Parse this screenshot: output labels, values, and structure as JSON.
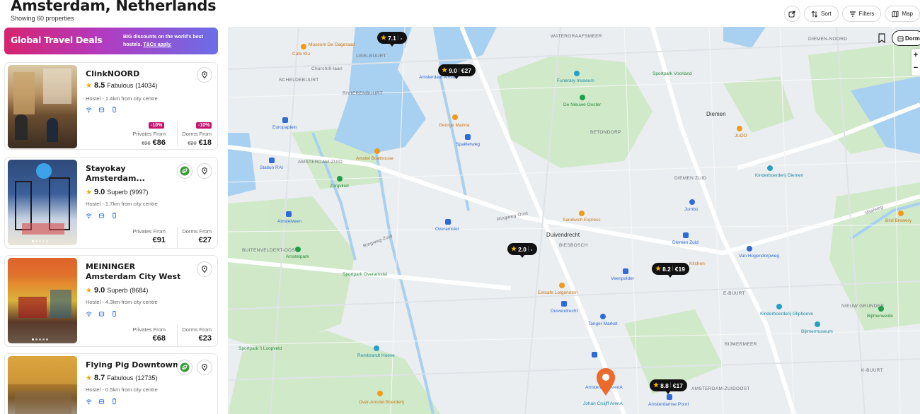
{
  "header": {
    "title": "Amsterdam, Netherlands",
    "subtitle": "Showing 60 properties",
    "sort_label": "Sort",
    "filters_label": "Filters",
    "map_label": "Map"
  },
  "banner": {
    "title": "Global Travel Deals",
    "text": "BIG discounts on the world's best hostels.",
    "link": "T&Cs apply."
  },
  "properties": [
    {
      "name": "ClinkNOORD",
      "score": "8.5",
      "rating_word": "Fabulous",
      "reviews": "(14034)",
      "meta": "Hostel - 1.4km from city centre",
      "privates_label": "Privates From",
      "privates_old": "€96",
      "privates_price": "€86",
      "privates_discount": "-10%",
      "dorms_label": "Dorms From",
      "dorms_old": "€20",
      "dorms_price": "€18",
      "dorms_discount": "-10%"
    },
    {
      "name": "Stayokay Amsterdam...",
      "score": "9.0",
      "rating_word": "Superb",
      "reviews": "(9997)",
      "meta": "Hostel - 1.7km from city centre",
      "privates_label": "Privates From",
      "privates_price": "€91",
      "dorms_label": "Dorms From",
      "dorms_price": "€27"
    },
    {
      "name": "MEININGER Amsterdam City West",
      "score": "9.0",
      "rating_word": "Superb",
      "reviews": "(8684)",
      "meta": "Hostel - 4.3km from city centre",
      "privates_label": "Privates From",
      "privates_price": "€68",
      "dorms_label": "Dorms From",
      "dorms_price": "€23"
    },
    {
      "name": "Flying Pig Downtown",
      "score": "8.7",
      "rating_word": "Fabulous",
      "reviews": "(12735)",
      "meta": "Hostel - 0.5km from city centre"
    }
  ],
  "map": {
    "dorms_chip": "Dorms",
    "zoom_in": "+",
    "zoom_out": "−",
    "markers": [
      {
        "score": "7.1",
        "price": "-"
      },
      {
        "score": "9.0",
        "price": "€27"
      },
      {
        "score": "2.0",
        "price": "-"
      },
      {
        "score": "8.2",
        "price": "€19"
      },
      {
        "score": "8.8",
        "price": "€17"
      }
    ],
    "area_labels": [
      "WATERGRAAFSMEER",
      "IJSELBUURT",
      "SCHELDEBUURT",
      "Churchill-laan",
      "RIVIERENBUURT",
      "AMSTERDAM-ZUID",
      "BETONDORP",
      "DIEMEN ZUID",
      "BIESBOSCH",
      "BUITENVELDERT-OOST",
      "E-BUURT",
      "NIEUW GRUNDER",
      "BIJMERMEER",
      "K-BUURT",
      "AMSTERDAM-ZUIDOOST",
      "DIEMEN-NOORD",
      "Ringweg-Zuid",
      "Ringweg-Oost",
      "Vaalweg",
      "Diemen",
      "Duivendrecht"
    ],
    "place_labels": [
      "Museum De Dageraad",
      "Cafe Klu",
      "Amsterdam Amstel",
      "Funerary museum",
      "Sportpark Voorland",
      "De Nieuwe Ooster",
      "Europaplein",
      "George Marina",
      "Spaklerweg",
      "JUDO",
      "Amstel Boathouse",
      "Station RAI",
      "Zorgvlied",
      "Kinderboerderij Diemen",
      "Jumbo",
      "Amstelveen",
      "Overamstel",
      "Sandwich Express",
      "Bird Brewery",
      "Amstelpark",
      "Diemen Zuid",
      "Van Hogendorpweg",
      "Sportpark Overamstel",
      "Veenpolder",
      "Kitchen",
      "Eetcafe Lotgenoten",
      "Duivendrecht",
      "Tanger Market",
      "Kinderboerderij Gliphoeve",
      "Bijlmerweide",
      "Bijlmermuseum",
      "Sportpark 't Loopveld",
      "Rembrandt Hoeve",
      "Amsterdam ArenA",
      "Johan Cruijff ArenA",
      "Amsterdamse Poort",
      "Over-Amstel Boerderij"
    ]
  }
}
